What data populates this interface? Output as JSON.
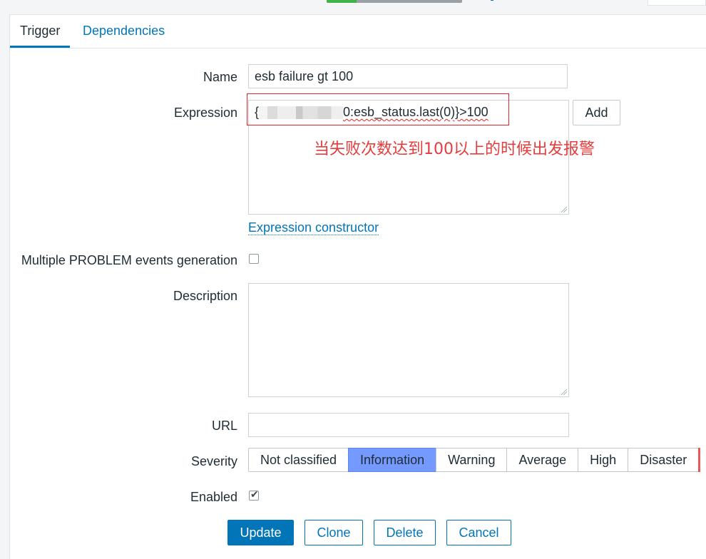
{
  "tabs": [
    {
      "label": "Trigger",
      "active": true
    },
    {
      "label": "Dependencies",
      "active": false
    }
  ],
  "form": {
    "name": {
      "label": "Name",
      "value": "esb failure gt 100"
    },
    "expression": {
      "label": "Expression",
      "prefix": "{",
      "suffix": "0:esb_status.last(0)}>100",
      "add_label": "Add",
      "constructor_link": "Expression constructor"
    },
    "multiple_problem": {
      "label": "Multiple PROBLEM events generation",
      "checked": false
    },
    "description": {
      "label": "Description",
      "value": ""
    },
    "url": {
      "label": "URL",
      "value": ""
    },
    "severity": {
      "label": "Severity",
      "options": [
        "Not classified",
        "Information",
        "Warning",
        "Average",
        "High",
        "Disaster"
      ],
      "selected": "Information"
    },
    "enabled": {
      "label": "Enabled",
      "checked": true
    }
  },
  "actions": {
    "update": "Update",
    "clone": "Clone",
    "delete": "Delete",
    "cancel": "Cancel"
  },
  "annotation": {
    "text": "当失败次数达到100以上的时候出发报警",
    "color": "#e33d3d"
  },
  "colors": {
    "accent": "#0275b8",
    "selected_severity": "#7499ff",
    "disaster": "#e45959"
  }
}
